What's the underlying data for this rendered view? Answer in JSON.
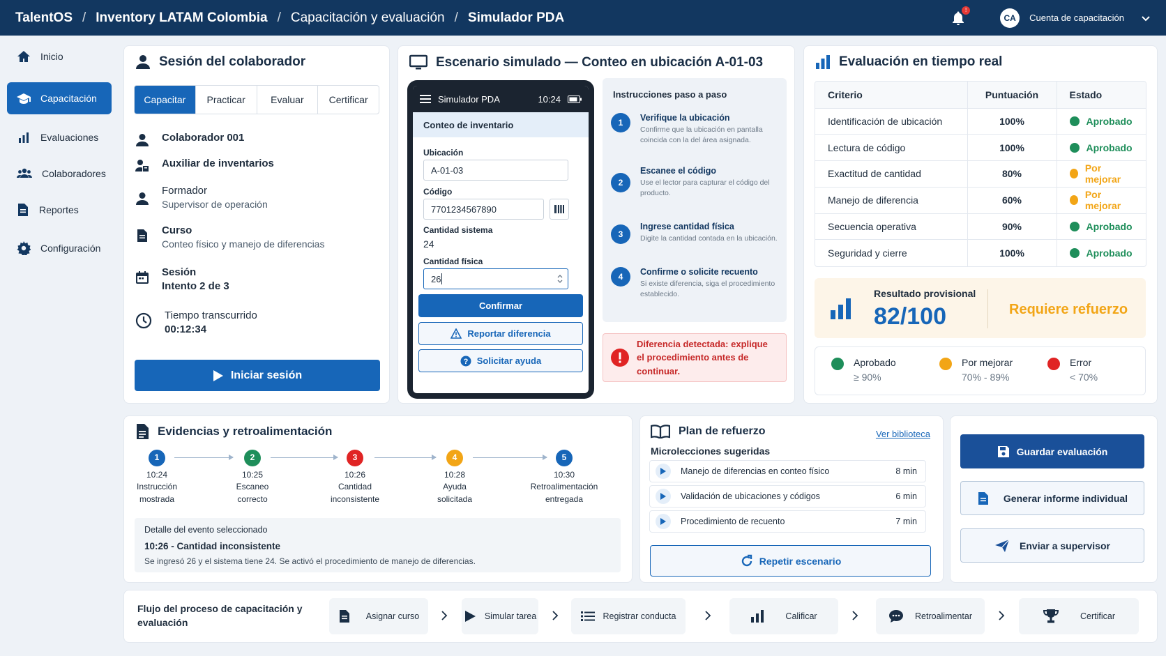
{
  "breadcrumb": [
    "TalentOS",
    "Inventory LATAM Colombia",
    "Capacitación y evaluación",
    "Simulador PDA"
  ],
  "header": {
    "notifications": "!",
    "avatar": "CA",
    "account": "Cuenta de capacitación"
  },
  "sidebar": {
    "items": [
      "Inicio",
      "Capacitación",
      "Evaluaciones",
      "Colaboradores",
      "Reportes",
      "Configuración"
    ],
    "active": "Capacitación"
  },
  "session": {
    "title": "Sesión del colaborador",
    "tabs": [
      "Capacitar",
      "Practicar",
      "Evaluar",
      "Certificar"
    ],
    "collaborator": "Colaborador 001",
    "role": "Auxiliar de inventarios",
    "trainer_label": "Formador",
    "trainer": "Supervisor de operación",
    "course_label": "Curso",
    "course": "Conteo físico y manejo de diferencias",
    "session_label": "Sesión",
    "attempt": "Intento 2 de 3",
    "time_label": "Tiempo transcurrido",
    "time": "00:12:34",
    "start_button": "Iniciar sesión"
  },
  "scenario": {
    "title": "Escenario simulado — Conteo en ubicación A-01-03",
    "pda": {
      "app_title": "Simulador PDA",
      "clock": "10:24",
      "screen_title": "Conteo de inventario",
      "location_label": "Ubicación",
      "location": "A-01-03",
      "code_label": "Código",
      "code": "7701234567890",
      "system_qty_label": "Cantidad sistema",
      "system_qty": "24",
      "physical_qty_label": "Cantidad física",
      "physical_qty": "26",
      "confirm": "Confirmar",
      "report": "Reportar diferencia",
      "help": "Solicitar ayuda"
    },
    "instructions_title": "Instrucciones paso a paso",
    "steps": [
      {
        "n": "1",
        "title": "Verifique la ubicación",
        "desc": "Confirme que la ubicación en pantalla coincida con la del área asignada."
      },
      {
        "n": "2",
        "title": "Escanee el código",
        "desc": "Use el lector para capturar el código del producto."
      },
      {
        "n": "3",
        "title": "Ingrese cantidad física",
        "desc": "Digite la cantidad contada en la ubicación."
      },
      {
        "n": "4",
        "title": "Confirme o solicite recuento",
        "desc": "Si existe diferencia, siga el procedimiento establecido."
      }
    ],
    "alert": "Diferencia detectada: explique el procedimiento antes de continuar."
  },
  "evaluation": {
    "title": "Evaluación en tiempo real",
    "columns": [
      "Criterio",
      "Puntuación",
      "Estado"
    ],
    "rows": [
      {
        "criterion": "Identificación de ubicación",
        "score": "100%",
        "status": "Aprobado",
        "color": "#1e8e5a"
      },
      {
        "criterion": "Lectura de código",
        "score": "100%",
        "status": "Aprobado",
        "color": "#1e8e5a"
      },
      {
        "criterion": "Exactitud de cantidad",
        "score": "80%",
        "status": "Por mejorar",
        "color": "#f2a516"
      },
      {
        "criterion": "Manejo de diferencia",
        "score": "60%",
        "status": "Por mejorar",
        "color": "#f2a516"
      },
      {
        "criterion": "Secuencia operativa",
        "score": "90%",
        "status": "Aprobado",
        "color": "#1e8e5a"
      },
      {
        "criterion": "Seguridad y cierre",
        "score": "100%",
        "status": "Aprobado",
        "color": "#1e8e5a"
      }
    ],
    "result_label": "Resultado provisional",
    "result": "82/100",
    "verdict": "Requiere refuerzo",
    "legend": [
      {
        "label": "Aprobado",
        "range": "≥ 90%",
        "color": "#1e8e5a"
      },
      {
        "label": "Por mejorar",
        "range": "70% - 89%",
        "color": "#f2a516"
      },
      {
        "label": "Error",
        "range": "< 70%",
        "color": "#e02424"
      }
    ]
  },
  "evidence": {
    "title": "Evidencias y retroalimentación",
    "events": [
      {
        "n": "1",
        "time": "10:24",
        "label": "Instrucción mostrada",
        "color": "#1766b8"
      },
      {
        "n": "2",
        "time": "10:25",
        "label": "Escaneo correcto",
        "color": "#1e8e5a"
      },
      {
        "n": "3",
        "time": "10:26",
        "label": "Cantidad inconsistente",
        "color": "#e02424"
      },
      {
        "n": "4",
        "time": "10:28",
        "label": "Ayuda solicitada",
        "color": "#f2a516"
      },
      {
        "n": "5",
        "time": "10:30",
        "label": "Retroalimentación entregada",
        "color": "#1766b8"
      }
    ],
    "detail_label": "Detalle del evento seleccionado",
    "detail_title": "10:26 - Cantidad inconsistente",
    "detail_text": "Se ingresó 26 y el sistema tiene 24. Se activó el procedimiento de manejo de diferencias."
  },
  "reinforcement": {
    "title": "Plan de refuerzo",
    "library_link": "Ver biblioteca",
    "subtitle": "Microlecciones sugeridas",
    "lessons": [
      {
        "title": "Manejo de diferencias en conteo físico",
        "duration": "8 min"
      },
      {
        "title": "Validación de ubicaciones y códigos",
        "duration": "6 min"
      },
      {
        "title": "Procedimiento de recuento",
        "duration": "7 min"
      }
    ],
    "repeat": "Repetir escenario"
  },
  "actions": {
    "save": "Guardar evaluación",
    "report": "Generar informe individual",
    "send": "Enviar a supervisor"
  },
  "flow": {
    "title": "Flujo del proceso de capacitación y evaluación",
    "steps": [
      "Asignar curso",
      "Simular tarea",
      "Registrar conducta",
      "Calificar",
      "Retroalimentar",
      "Certificar"
    ]
  },
  "colors": {
    "primary": "#1766b8",
    "topbar": "#123760",
    "success": "#1e8e5a",
    "warning": "#f2a516",
    "error": "#e02424"
  }
}
